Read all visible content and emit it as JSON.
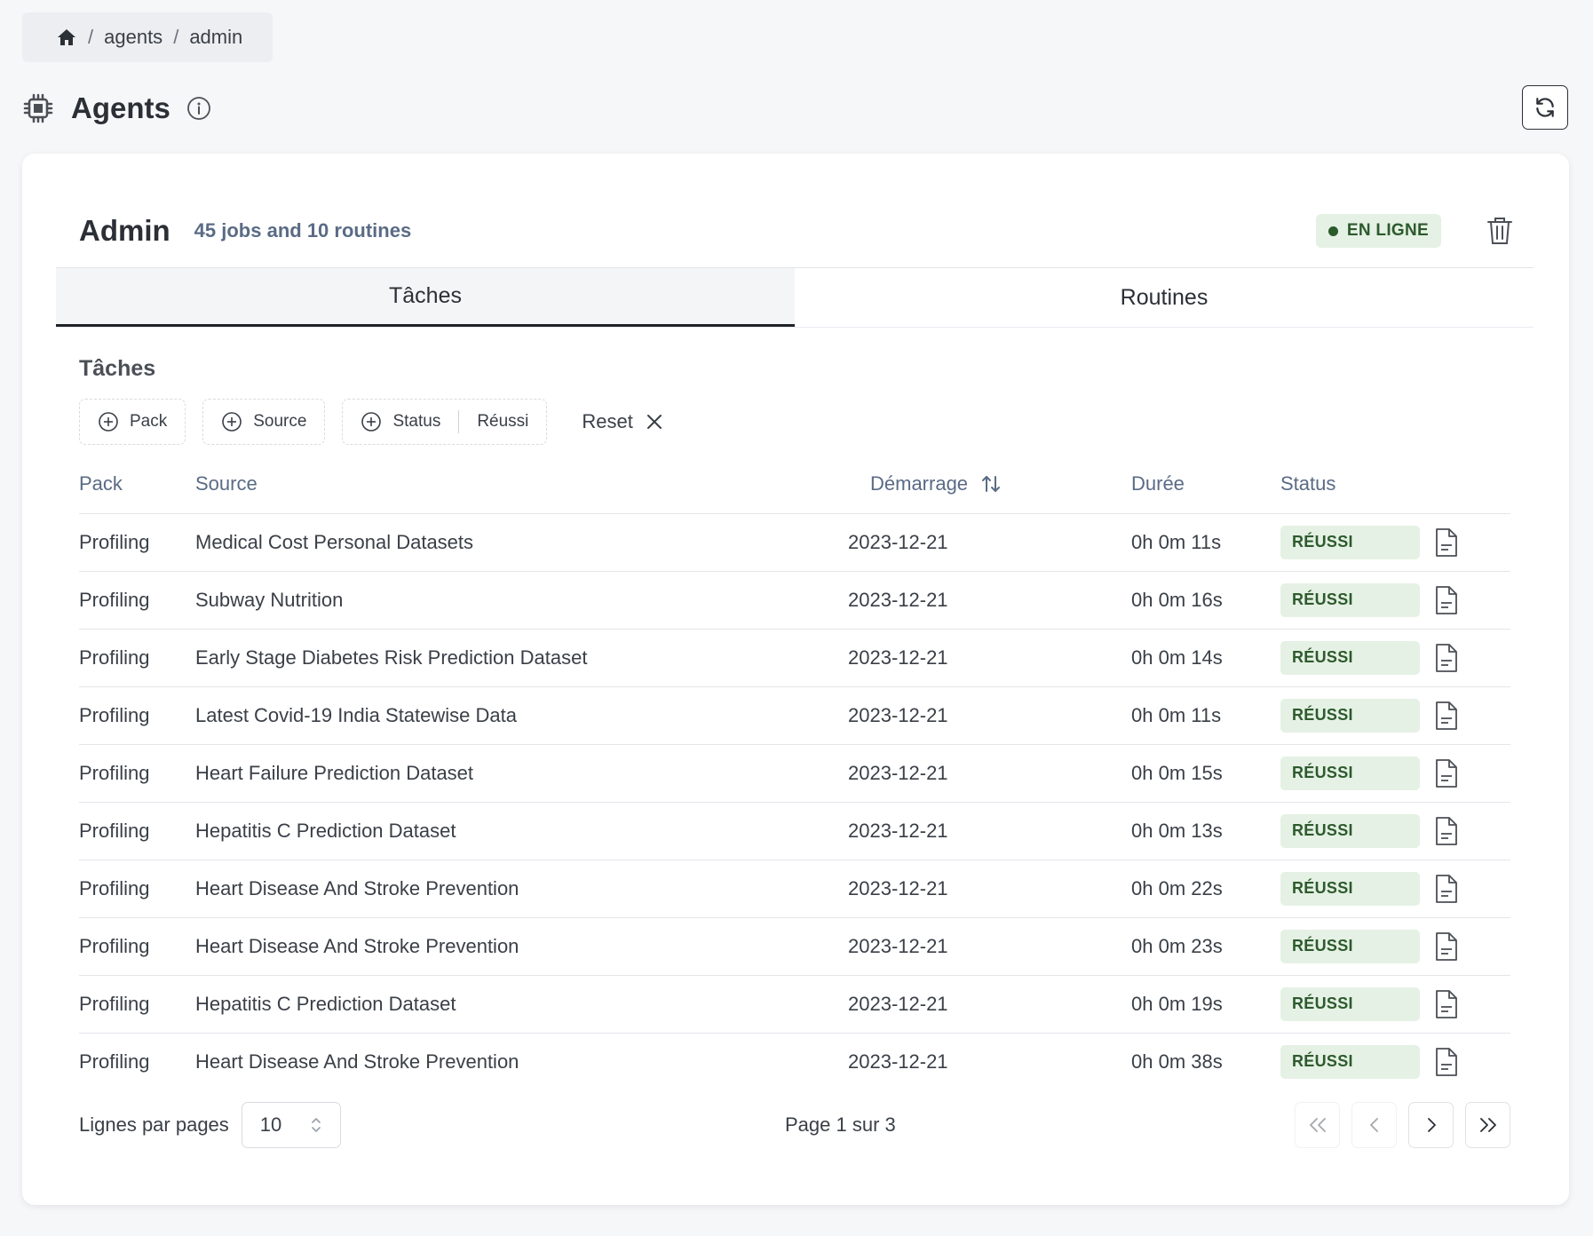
{
  "breadcrumb": {
    "items": [
      "agents",
      "admin"
    ],
    "separator": "/"
  },
  "page": {
    "title": "Agents"
  },
  "agent": {
    "name": "Admin",
    "summary": "45 jobs and 10 routines",
    "status": "EN LIGNE"
  },
  "tabs": [
    {
      "label": "Tâches",
      "active": true
    },
    {
      "label": "Routines",
      "active": false
    }
  ],
  "section": {
    "title": "Tâches"
  },
  "filters": {
    "pack": "Pack",
    "source": "Source",
    "status": "Status",
    "status_value": "Réussi",
    "reset": "Reset"
  },
  "table": {
    "headers": {
      "pack": "Pack",
      "source": "Source",
      "start": "Démarrage",
      "duration": "Durée",
      "status": "Status"
    },
    "rows": [
      {
        "pack": "Profiling",
        "source": "Medical Cost Personal Datasets",
        "start": "2023-12-21",
        "duration": "0h 0m 11s",
        "status": "RÉUSSI"
      },
      {
        "pack": "Profiling",
        "source": "Subway Nutrition",
        "start": "2023-12-21",
        "duration": "0h 0m 16s",
        "status": "RÉUSSI"
      },
      {
        "pack": "Profiling",
        "source": "Early Stage Diabetes Risk Prediction Dataset",
        "start": "2023-12-21",
        "duration": "0h 0m 14s",
        "status": "RÉUSSI"
      },
      {
        "pack": "Profiling",
        "source": "Latest Covid-19 India Statewise Data",
        "start": "2023-12-21",
        "duration": "0h 0m 11s",
        "status": "RÉUSSI"
      },
      {
        "pack": "Profiling",
        "source": "Heart Failure Prediction Dataset",
        "start": "2023-12-21",
        "duration": "0h 0m 15s",
        "status": "RÉUSSI"
      },
      {
        "pack": "Profiling",
        "source": "Hepatitis C Prediction Dataset",
        "start": "2023-12-21",
        "duration": "0h 0m 13s",
        "status": "RÉUSSI"
      },
      {
        "pack": "Profiling",
        "source": "Heart Disease And Stroke Prevention",
        "start": "2023-12-21",
        "duration": "0h 0m 22s",
        "status": "RÉUSSI"
      },
      {
        "pack": "Profiling",
        "source": "Heart Disease And Stroke Prevention",
        "start": "2023-12-21",
        "duration": "0h 0m 23s",
        "status": "RÉUSSI"
      },
      {
        "pack": "Profiling",
        "source": "Hepatitis C Prediction Dataset",
        "start": "2023-12-21",
        "duration": "0h 0m 19s",
        "status": "RÉUSSI"
      },
      {
        "pack": "Profiling",
        "source": "Heart Disease And Stroke Prevention",
        "start": "2023-12-21",
        "duration": "0h 0m 38s",
        "status": "RÉUSSI"
      }
    ]
  },
  "pagination": {
    "rows_label": "Lignes par pages",
    "rows_per_page": "10",
    "page_info": "Page 1 sur 3"
  },
  "icons": {
    "home": "home-icon",
    "agent": "cpu-chip-icon",
    "info": "info-icon",
    "refresh": "refresh-icon",
    "delete": "trash-icon",
    "add": "plus-circle-icon",
    "reset": "close-icon",
    "sort": "sort-arrows-icon",
    "report": "document-icon",
    "select": "chevron-up-down-icon",
    "first": "double-chevron-left-icon",
    "prev": "chevron-left-icon",
    "next": "chevron-right-icon",
    "last": "double-chevron-right-icon"
  },
  "colors": {
    "success_bg": "#e5f1e4",
    "success_text": "#2d5a2d",
    "header_text": "#5a6b85"
  }
}
